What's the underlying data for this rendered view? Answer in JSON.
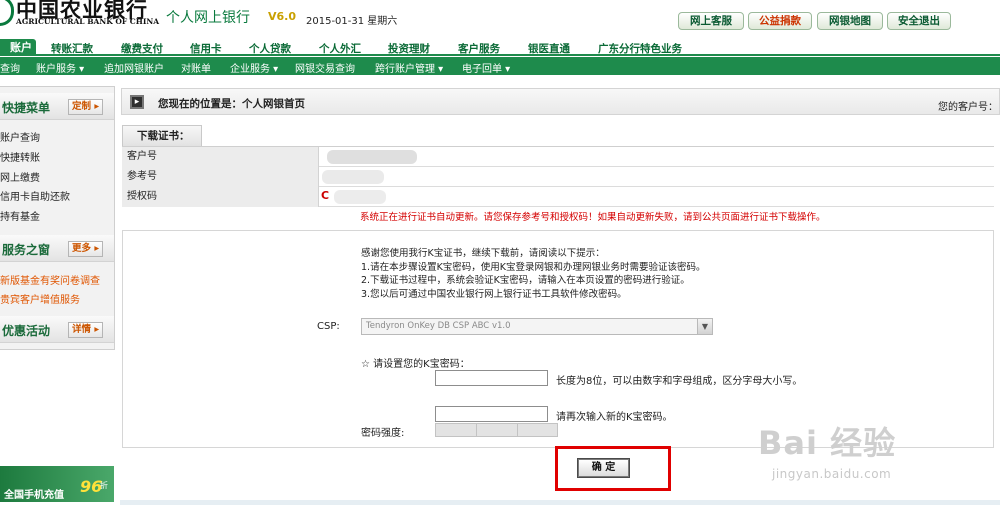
{
  "header": {
    "bank_name_cn": "中国农业银行",
    "bank_name_en": "AGRICULTURAL BANK OF CHINA",
    "site_title": "个人网上银行",
    "version": "V6.0",
    "date": "2015-01-31 星期六",
    "buttons": [
      "网上客服",
      "公益捐款",
      "网银地图",
      "安全退出"
    ]
  },
  "nav": {
    "active": "账户",
    "items": [
      "转账汇款",
      "缴费支付",
      "信用卡",
      "个人贷款",
      "个人外汇",
      "投资理财",
      "客户服务",
      "银医直通",
      "广东分行特色业务"
    ]
  },
  "subnav": {
    "items": [
      "查询",
      "账户服务 ▾",
      "追加网银账户",
      "对账单",
      "企业服务 ▾",
      "网银交易查询",
      "跨行账户管理 ▾",
      "电子回单 ▾"
    ]
  },
  "sidebar": {
    "quick_menu": {
      "title": "快捷菜单",
      "button": "定制",
      "links": [
        "账户查询",
        "快捷转账",
        "网上缴费",
        "信用卡自助还款",
        "持有基金"
      ]
    },
    "service_window": {
      "title": "服务之窗",
      "button": "更多",
      "links": [
        "新版基金有奖问卷调查",
        "贵宾客户增值服务"
      ]
    },
    "promotions": {
      "title": "优惠活动",
      "button": "详情"
    },
    "banner": {
      "text": "全国手机充值",
      "discount": "96",
      "unit": "折"
    }
  },
  "main": {
    "location": "您现在的位置是：个人网银首页",
    "customer_no_label": "您的客户号：",
    "cert_tab": "下载证书：",
    "cert_rows": [
      {
        "label": "客户号"
      },
      {
        "label": "参考号"
      },
      {
        "label": "授权码",
        "value": "C"
      }
    ],
    "warning": "系统正在进行证书自动更新。请您保存参考号和授权码！如果自动更新失败，请到公共页面进行证书下载操作。",
    "hint_lines": [
      "感谢您使用我行K宝证书，继续下载前，请阅读以下提示：",
      "1.请在本步骤设置K宝密码，使用K宝登录网银和办理网银业务时需要验证该密码。",
      "2.下载证书过程中，系统会验证K宝密码，请输入在本页设置的密码进行验证。",
      "3.您以后可通过中国农业银行网上银行证书工具软件修改密码。"
    ],
    "csp_label": "CSP:",
    "csp_value": "Tendyron OnKey DB CSP ABC v1.0",
    "set_password_label": "☆ 请设置您的K宝密码：",
    "password_hint": "长度为8位，可以由数字和字母组成，区分字母大小写。",
    "confirm_hint": "请再次输入新的K宝密码。",
    "strength_label": "密码强度:",
    "confirm_button": "确 定"
  },
  "watermark": {
    "logo": "Bai 经验",
    "url": "jingyan.baidu.com"
  }
}
